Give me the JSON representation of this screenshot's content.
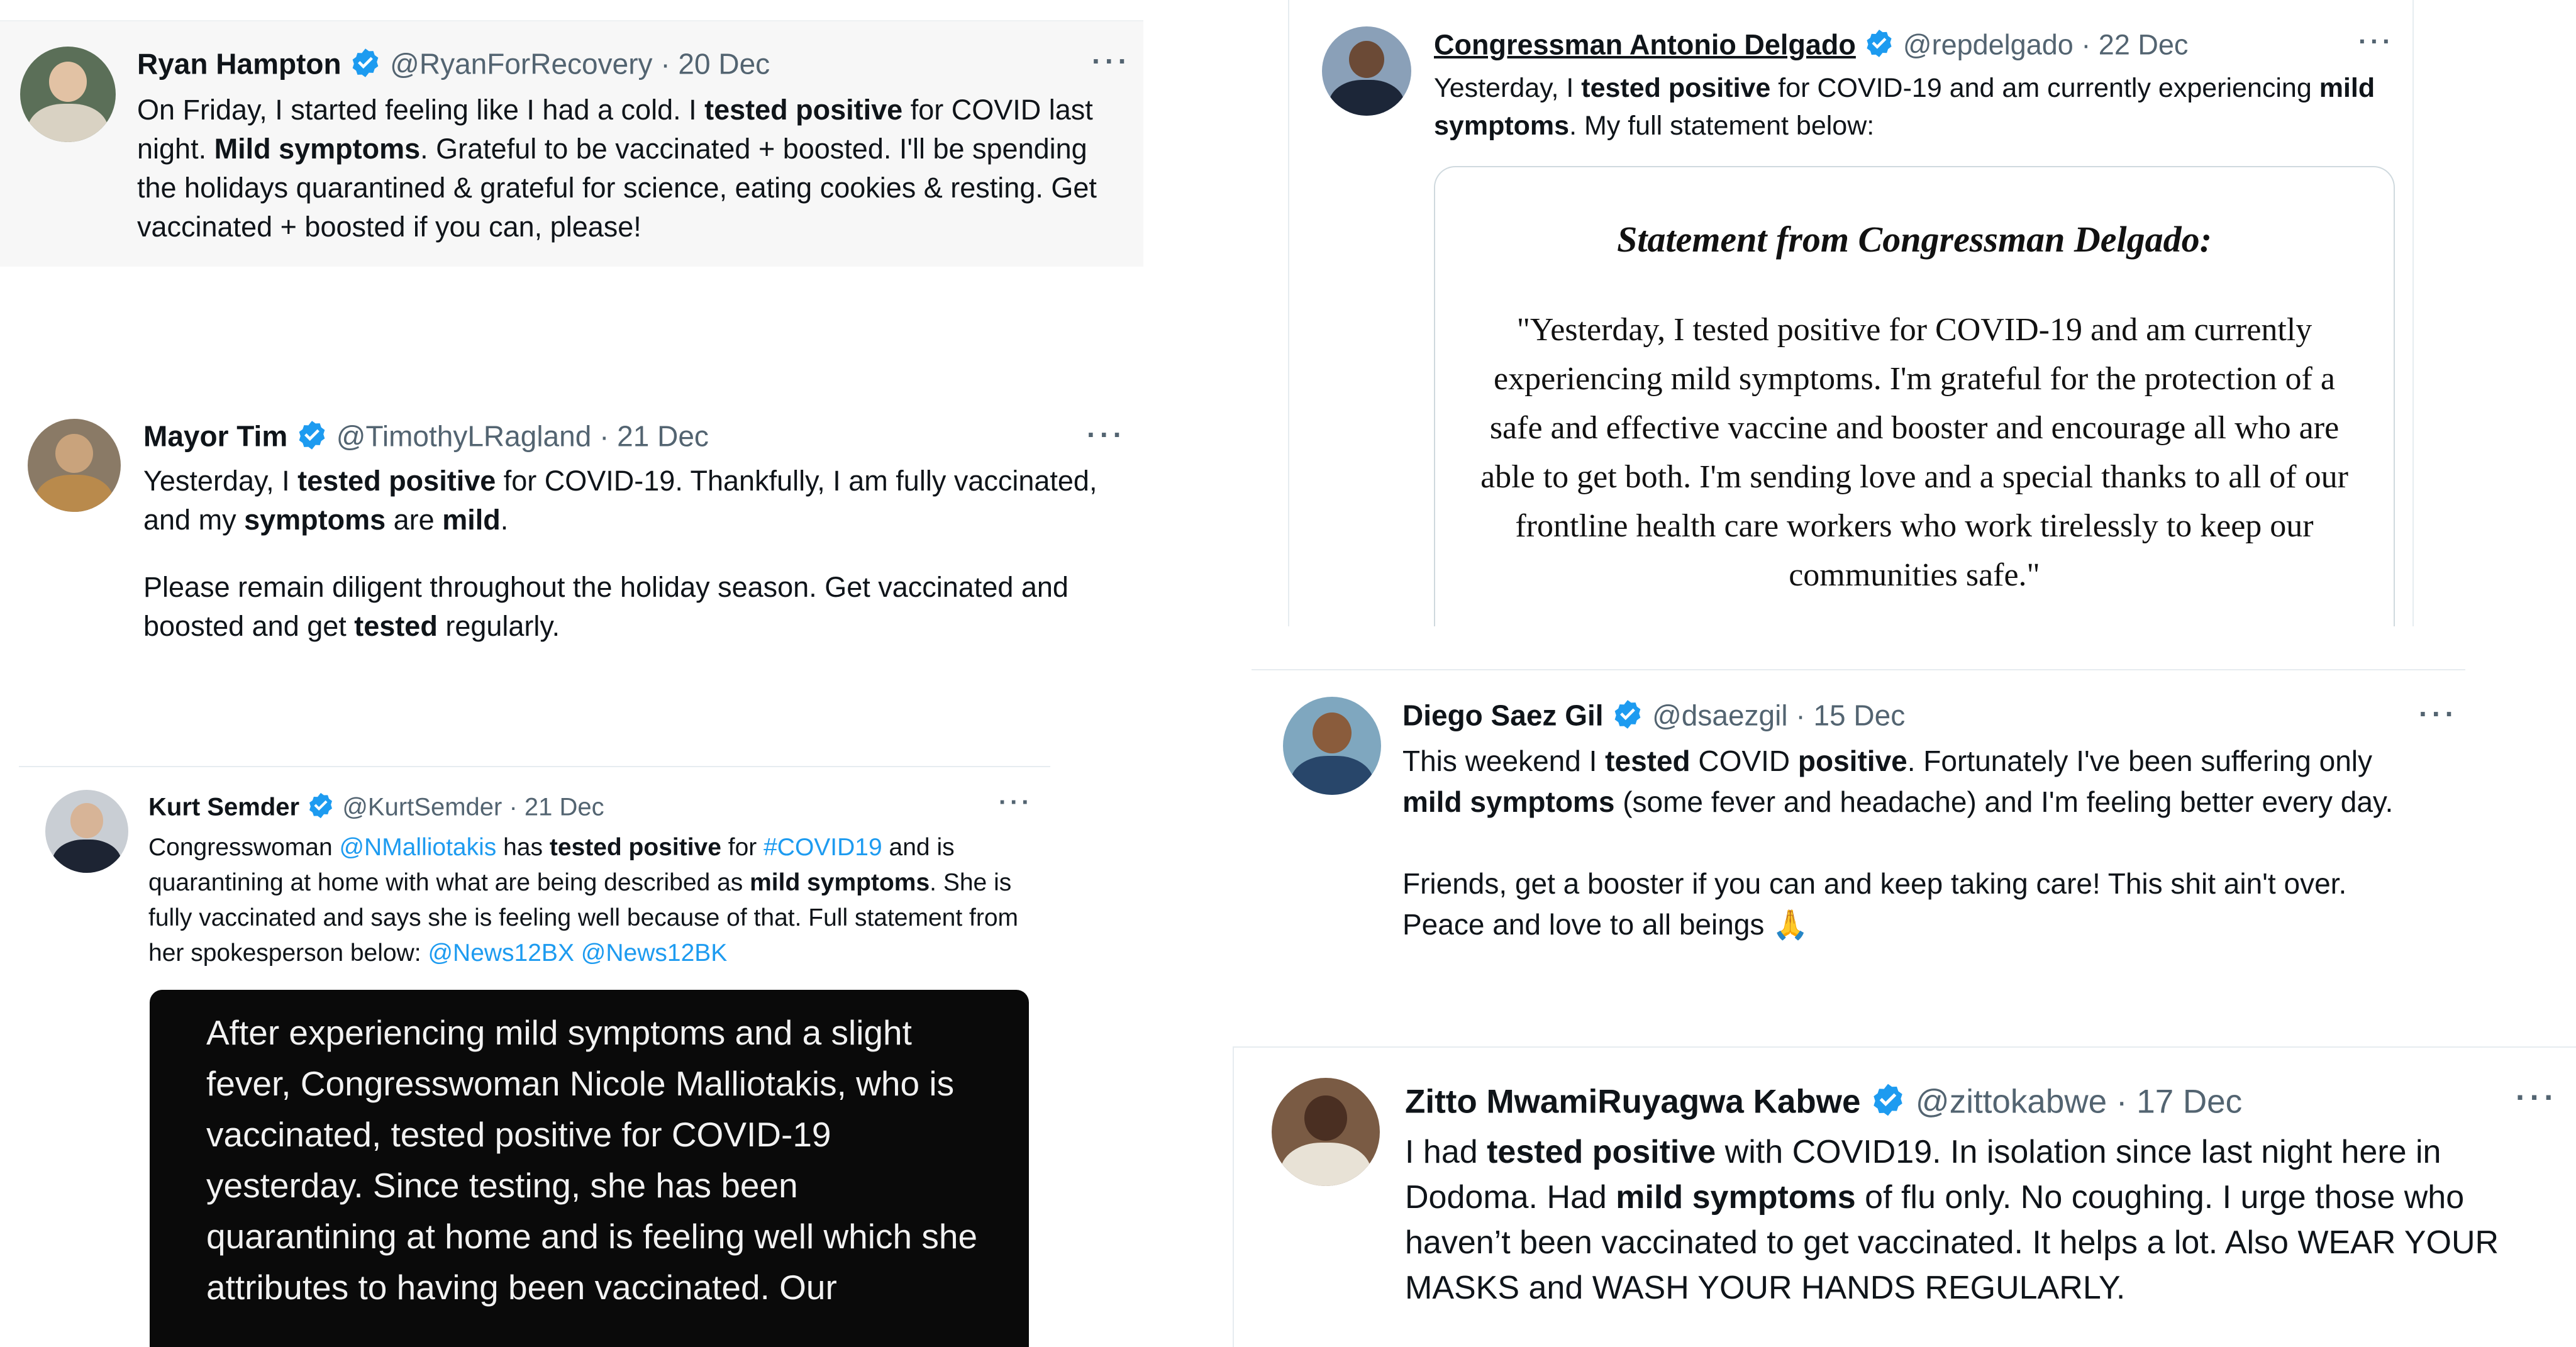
{
  "tweets": {
    "hampton": {
      "name": "Ryan Hampton",
      "handle": "@RyanForRecovery",
      "date": "· 20 Dec",
      "text": [
        {
          "t": "On Friday, I started feeling like I had a cold. I "
        },
        {
          "t": "tested positive",
          "b": true
        },
        {
          "t": " for COVID last night. "
        },
        {
          "t": "Mild symptoms",
          "b": true
        },
        {
          "t": ". Grateful to be vaccinated + boosted. I'll be spending the holidays quarantined & grateful for science, eating cookies & resting. Get vaccinated + boosted if you can, please!"
        }
      ]
    },
    "tim": {
      "name": "Mayor Tim",
      "handle": "@TimothyLRagland",
      "date": "· 21 Dec",
      "para1": [
        {
          "t": "Yesterday, I "
        },
        {
          "t": "tested positive",
          "b": true
        },
        {
          "t": " for COVID-19. Thankfully, I am fully vaccinated, and my "
        },
        {
          "t": "symptoms",
          "b": true
        },
        {
          "t": " are "
        },
        {
          "t": "mild",
          "b": true
        },
        {
          "t": "."
        }
      ],
      "para2": [
        {
          "t": "Please remain diligent throughout the holiday season. Get vaccinated and boosted and get "
        },
        {
          "t": "tested",
          "b": true
        },
        {
          "t": " regularly."
        }
      ]
    },
    "semder": {
      "name": "Kurt Semder",
      "handle": "@KurtSemder",
      "date": "· 21 Dec",
      "text": [
        {
          "t": "Congresswoman "
        },
        {
          "t": "@NMalliotakis",
          "link": true
        },
        {
          "t": " has "
        },
        {
          "t": "tested positive",
          "b": true
        },
        {
          "t": " for "
        },
        {
          "t": "#COVID19",
          "link": true
        },
        {
          "t": " and is quarantining at home with what are being described as "
        },
        {
          "t": "mild symptoms",
          "b": true
        },
        {
          "t": ". She is fully vaccinated and says she is feeling well because of that. Full statement from her spokesperson below: "
        },
        {
          "t": "@News12BX",
          "link": true
        },
        {
          "t": " "
        },
        {
          "t": "@News12BK",
          "link": true
        }
      ],
      "card_text": "After experiencing mild symptoms and a slight fever, Congresswoman Nicole Malliotakis, who is vaccinated, tested positive for COVID-19 yesterday. Since testing, she has been quarantining at home and is feeling well which she attributes to having been vaccinated. Our"
    },
    "delgado": {
      "name": "Congressman Antonio Delgado",
      "handle": "@repdelgado",
      "date": "· 22 Dec",
      "text": [
        {
          "t": "Yesterday, I "
        },
        {
          "t": "tested positive",
          "b": true
        },
        {
          "t": " for COVID-19 and am currently experiencing "
        },
        {
          "t": "mild symptoms",
          "b": true
        },
        {
          "t": ". My full statement below:"
        }
      ],
      "statement_title": "Statement from Congressman Delgado:",
      "statement_body": "\"Yesterday, I tested positive for COVID-19 and am currently experiencing mild symptoms. I'm grateful for the protection of a safe and effective vaccine and booster and encourage all who are able to get both. I'm sending love and a special thanks to all of our frontline health care workers who work tirelessly to keep our communities safe.\""
    },
    "saezgil": {
      "name": "Diego Saez Gil",
      "handle": "@dsaezgil",
      "date": "· 15 Dec",
      "para1": [
        {
          "t": "This weekend I "
        },
        {
          "t": "tested",
          "b": true
        },
        {
          "t": " COVID "
        },
        {
          "t": "positive",
          "b": true
        },
        {
          "t": ". Fortunately I've been suffering only "
        },
        {
          "t": "mild symptoms",
          "b": true
        },
        {
          "t": " (some fever and headache) and I'm feeling better every day."
        }
      ],
      "para2": [
        {
          "t": "Friends, get a booster if you can and keep taking care! This shit ain't over. Peace and love to all beings 🙏"
        }
      ]
    },
    "kabwe": {
      "name": "Zitto MwamiRuyagwa Kabwe",
      "handle": "@zittokabwe",
      "date": "· 17 Dec",
      "text": [
        {
          "t": "I had "
        },
        {
          "t": "tested positive",
          "b": true
        },
        {
          "t": " with COVID19. In isolation since last night here in Dodoma. Had "
        },
        {
          "t": "mild symptoms",
          "b": true
        },
        {
          "t": " of flu only. No coughing. I urge those who haven’t been vaccinated to get vaccinated. It helps a lot. Also WEAR YOUR MASKS and WASH YOUR HANDS REGULARLY."
        }
      ]
    }
  },
  "more_glyph": "···",
  "icons": {
    "verified": "verified-badge-icon",
    "more": "more-options-icon"
  },
  "colors": {
    "text": "#0f1419",
    "meta": "#536471",
    "link": "#1d9bf0",
    "verified": "#1d9bf0",
    "highlight_bg": "#f7f7f7"
  }
}
